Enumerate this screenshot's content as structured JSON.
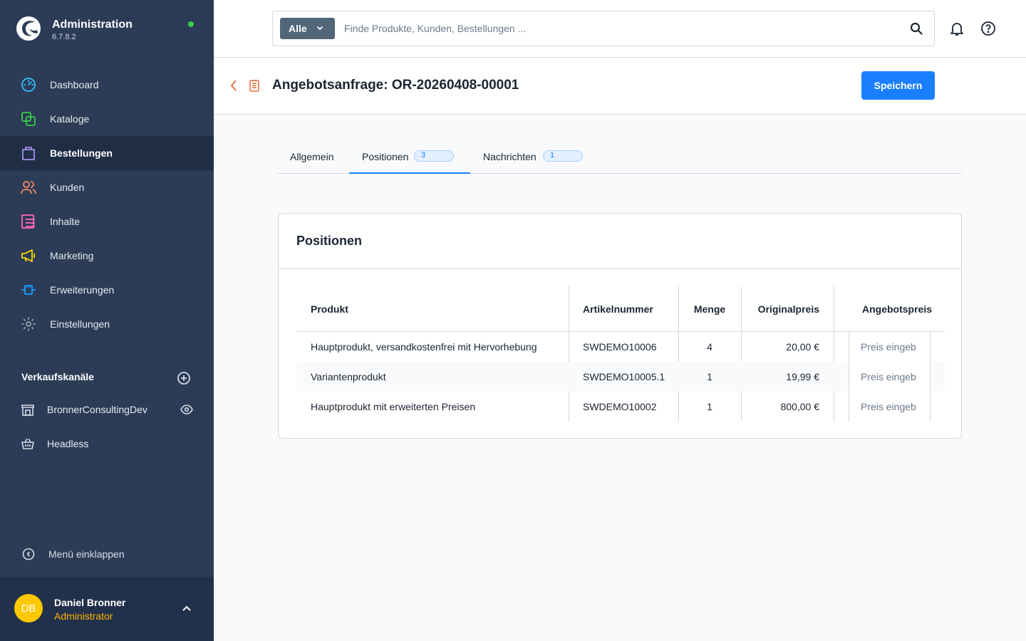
{
  "app": {
    "title": "Administration",
    "version": "6.7.8.2",
    "status_color": "#37d046"
  },
  "nav": {
    "items": [
      {
        "label": "Dashboard",
        "icon": "dashboard-icon",
        "color": "#2ec6ff"
      },
      {
        "label": "Kataloge",
        "icon": "catalog-icon",
        "color": "#37d046"
      },
      {
        "label": "Bestellungen",
        "icon": "shopping-bag-icon",
        "color": "#a092f0",
        "active": true
      },
      {
        "label": "Kunden",
        "icon": "customers-icon",
        "color": "#f88962"
      },
      {
        "label": "Inhalte",
        "icon": "content-icon",
        "color": "#ff68b4"
      },
      {
        "label": "Marketing",
        "icon": "megaphone-icon",
        "color": "#ffd700"
      },
      {
        "label": "Erweiterungen",
        "icon": "plug-icon",
        "color": "#189eff"
      },
      {
        "label": "Einstellungen",
        "icon": "gear-icon",
        "color": "#9aa8b5"
      }
    ]
  },
  "sales_channels": {
    "header": "Verkaufskanäle",
    "items": [
      {
        "label": "BronnerConsultingDev",
        "icon": "storefront-icon"
      },
      {
        "label": "Headless",
        "icon": "basket-icon"
      }
    ]
  },
  "collapse_label": "Menü einklappen",
  "user": {
    "initials": "DB",
    "name": "Daniel Bronner",
    "role": "Administrator",
    "avatar_color": "#ffc700"
  },
  "search": {
    "type_label": "Alle",
    "placeholder": "Finde Produkte, Kunden, Bestellungen ..."
  },
  "page": {
    "title": "Angebotsanfrage: OR-20260408-00001",
    "save_label": "Speichern",
    "accent": "#1a7fff"
  },
  "tabs": [
    {
      "label": "Allgemein"
    },
    {
      "label": "Positionen",
      "badge": "3",
      "active": true
    },
    {
      "label": "Nachrichten",
      "badge": "1"
    }
  ],
  "positions": {
    "title": "Positionen",
    "columns": [
      "Produkt",
      "Artikelnummer",
      "Menge",
      "Originalpreis",
      "Angebotspreis"
    ],
    "rows": [
      {
        "product": "Hauptprodukt, versandkostenfrei mit Hervorhebung",
        "sku": "SWDEMO10006",
        "qty": "4",
        "price": "20,00 €",
        "offer_placeholder": "Preis eingeb"
      },
      {
        "product": "Variantenprodukt",
        "sku": "SWDEMO10005.1",
        "qty": "1",
        "price": "19,99 €",
        "offer_placeholder": "Preis eingeb"
      },
      {
        "product": "Hauptprodukt mit erweiterten Preisen",
        "sku": "SWDEMO10002",
        "qty": "1",
        "price": "800,00 €",
        "offer_placeholder": "Preis eingeb"
      }
    ]
  }
}
